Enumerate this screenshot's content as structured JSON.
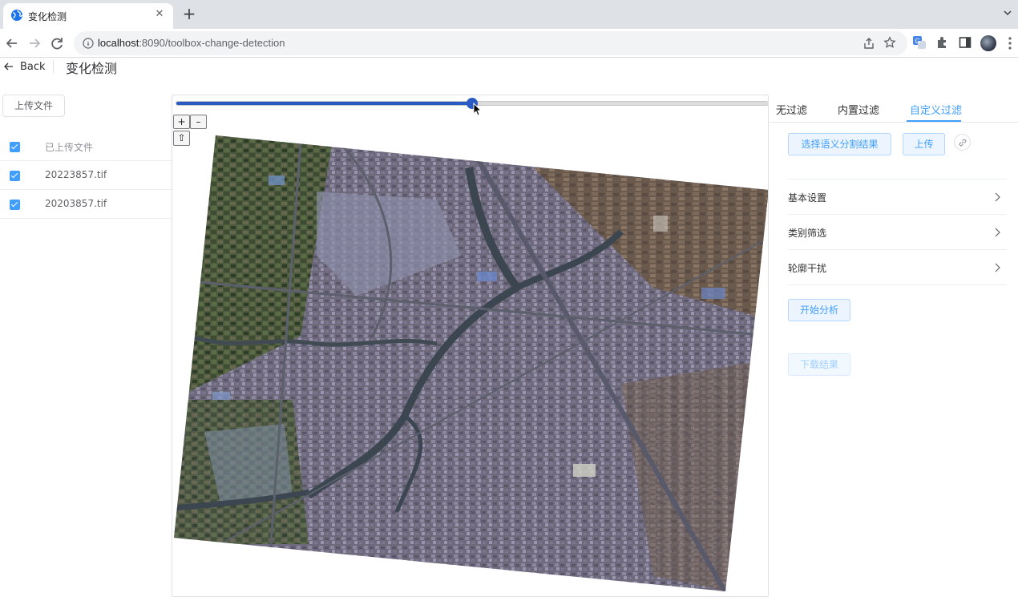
{
  "browser": {
    "tab_title": "变化检测",
    "close_label": "✕",
    "newtab_label": "+",
    "url_host": "localhost",
    "url_rest": ":8090/toolbox-change-detection"
  },
  "header": {
    "back_label": "Back",
    "title": "变化检测"
  },
  "left_panel": {
    "upload_label": "上传文件",
    "list_header": "已上传文件",
    "files": [
      "20223857.tif",
      "20203857.tif"
    ]
  },
  "map": {
    "slider_value_percent": 50,
    "zoom_in_label": "+",
    "zoom_out_label": "–",
    "extent_label": "⇧"
  },
  "right_panel": {
    "tabs": [
      "无过滤",
      "内置过滤",
      "自定义过滤"
    ],
    "active_tab": "自定义过滤",
    "select_seg_label": "选择语义分割结果",
    "upload_label": "上传",
    "sections": [
      "基本设置",
      "类别筛选",
      "轮廓干扰"
    ],
    "start_label": "开始分析",
    "download_label": "下载结果"
  },
  "colors": {
    "accent": "#409eff",
    "slider": "#2a5bc4"
  }
}
